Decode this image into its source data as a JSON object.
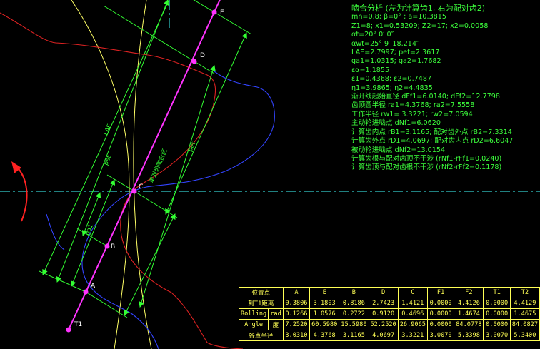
{
  "info": {
    "title": "啮合分析 (左为计算齿1, 右为配对齿2)",
    "lines": [
      "mn=0.8; β=0° ; a=10.3815",
      "Z1=8; x1=0.53209; Z2=17; x2=0.0058",
      "αt=20° 0′ 0″",
      "αwt=25° 9′ 18.214″",
      "LAE=2.7997; pet=2.3617",
      "ga1=1.0315; ga2=1.7682",
      "εα=1.1855",
      "ε1=0.4368; ε2=0.7487",
      "η1=3.9865; η2=4.4835",
      "渐开线起始直径 dFf1=6.0140; dFf2=12.7798",
      "齿顶圆半径 ra1=4.3768; ra2=7.5558",
      "工作半径 rw1= 3.3221; rw2=7.0594",
      "主动轮进啮点 dNf1=6.0620",
      "计算齿内点 rB1=3.1165; 配对齿外点 rB2=7.3314",
      "计算齿外点 rD1=4.0697; 配对齿内点 rD2=6.6047",
      "被动轮进啮点 dNf2=13.0154",
      "计算齿根与配对齿顶不干涉 (rNf1-rFf1=0.0240)",
      "计算齿顶与配对齿根不干涉 (rNf2-rFf2=0.1178)"
    ]
  },
  "diagram": {
    "points": [
      "T1",
      "A",
      "B",
      "C",
      "D",
      "E"
    ],
    "dim_labels": [
      "LAE",
      "pet",
      "pet",
      "ga1",
      "单对齿啮合区"
    ],
    "colors": {
      "line_of_action": "#ff33ff",
      "dimension": "#33ff33",
      "pitch_line": "#33cccc",
      "circle1": "#ffff66",
      "gear1": "#3344ff",
      "gear2": "#dd2222",
      "arrow": "#ff2222"
    }
  },
  "table": {
    "header": [
      "位置点",
      "A",
      "E",
      "B",
      "D",
      "C",
      "F1",
      "F2",
      "T1",
      "T2"
    ],
    "rows": [
      {
        "label": "到T1距离",
        "unit": "",
        "values": [
          "0.3806",
          "3.1803",
          "0.8186",
          "2.7423",
          "1.4121",
          "0.0000",
          "4.4126",
          "0.0000",
          "4.4129"
        ]
      },
      {
        "label": "Rolling",
        "unit": "rad",
        "values": [
          "0.1266",
          "1.0576",
          "0.2722",
          "0.9120",
          "0.4696",
          "0.0000",
          "1.4674",
          "0.0000",
          "1.4675"
        ]
      },
      {
        "label": "Angle",
        "unit": "度",
        "values": [
          "7.2520",
          "60.5980",
          "15.5980",
          "52.2520",
          "26.9065",
          "0.0000",
          "84.0778",
          "0.0000",
          "84.0827"
        ]
      },
      {
        "label": "各点半径",
        "unit": "",
        "values": [
          "3.0310",
          "4.3768",
          "3.1165",
          "4.0697",
          "3.3221",
          "3.0070",
          "5.3398",
          "3.0070",
          "5.3400"
        ]
      }
    ]
  }
}
